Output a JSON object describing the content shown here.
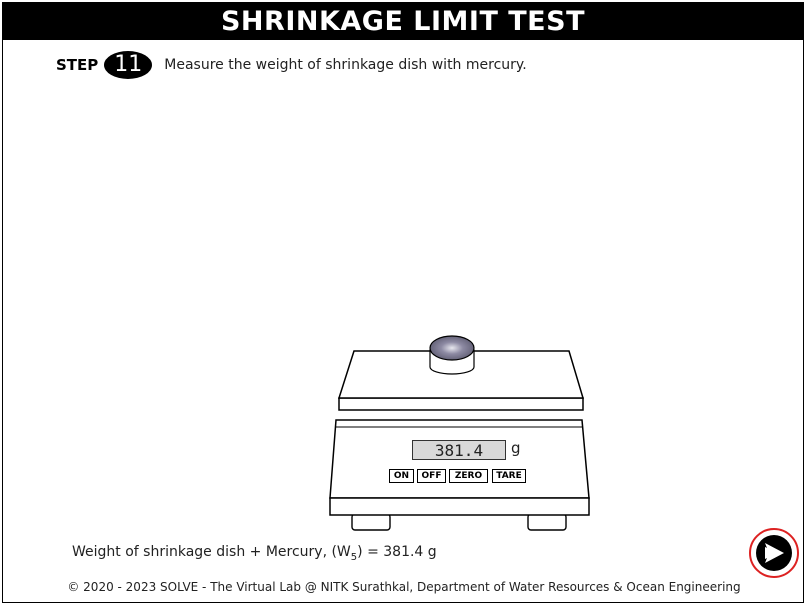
{
  "title": "SHRINKAGE LIMIT TEST",
  "step": {
    "label": "STEP",
    "number": "11",
    "instruction": "Measure the weight of shrinkage dish with mercury."
  },
  "scale": {
    "reading": "381.4",
    "unit": "g",
    "buttons": {
      "on": "ON",
      "off": "OFF",
      "zero": "ZERO",
      "tare": "TARE"
    }
  },
  "result": {
    "prefix": "Weight of shrinkage dish + Mercury, (W",
    "subscript": "5",
    "suffix": ") = 381.4 g"
  },
  "footer": "© 2020 - 2023 SOLVE - The Virtual Lab @ NITK Surathkal, Department of Water Resources & Ocean Engineering",
  "colors": {
    "accent_ring": "#dd2222",
    "title_bg": "#000000"
  },
  "icons": {
    "next": "next-arrow-icon"
  }
}
